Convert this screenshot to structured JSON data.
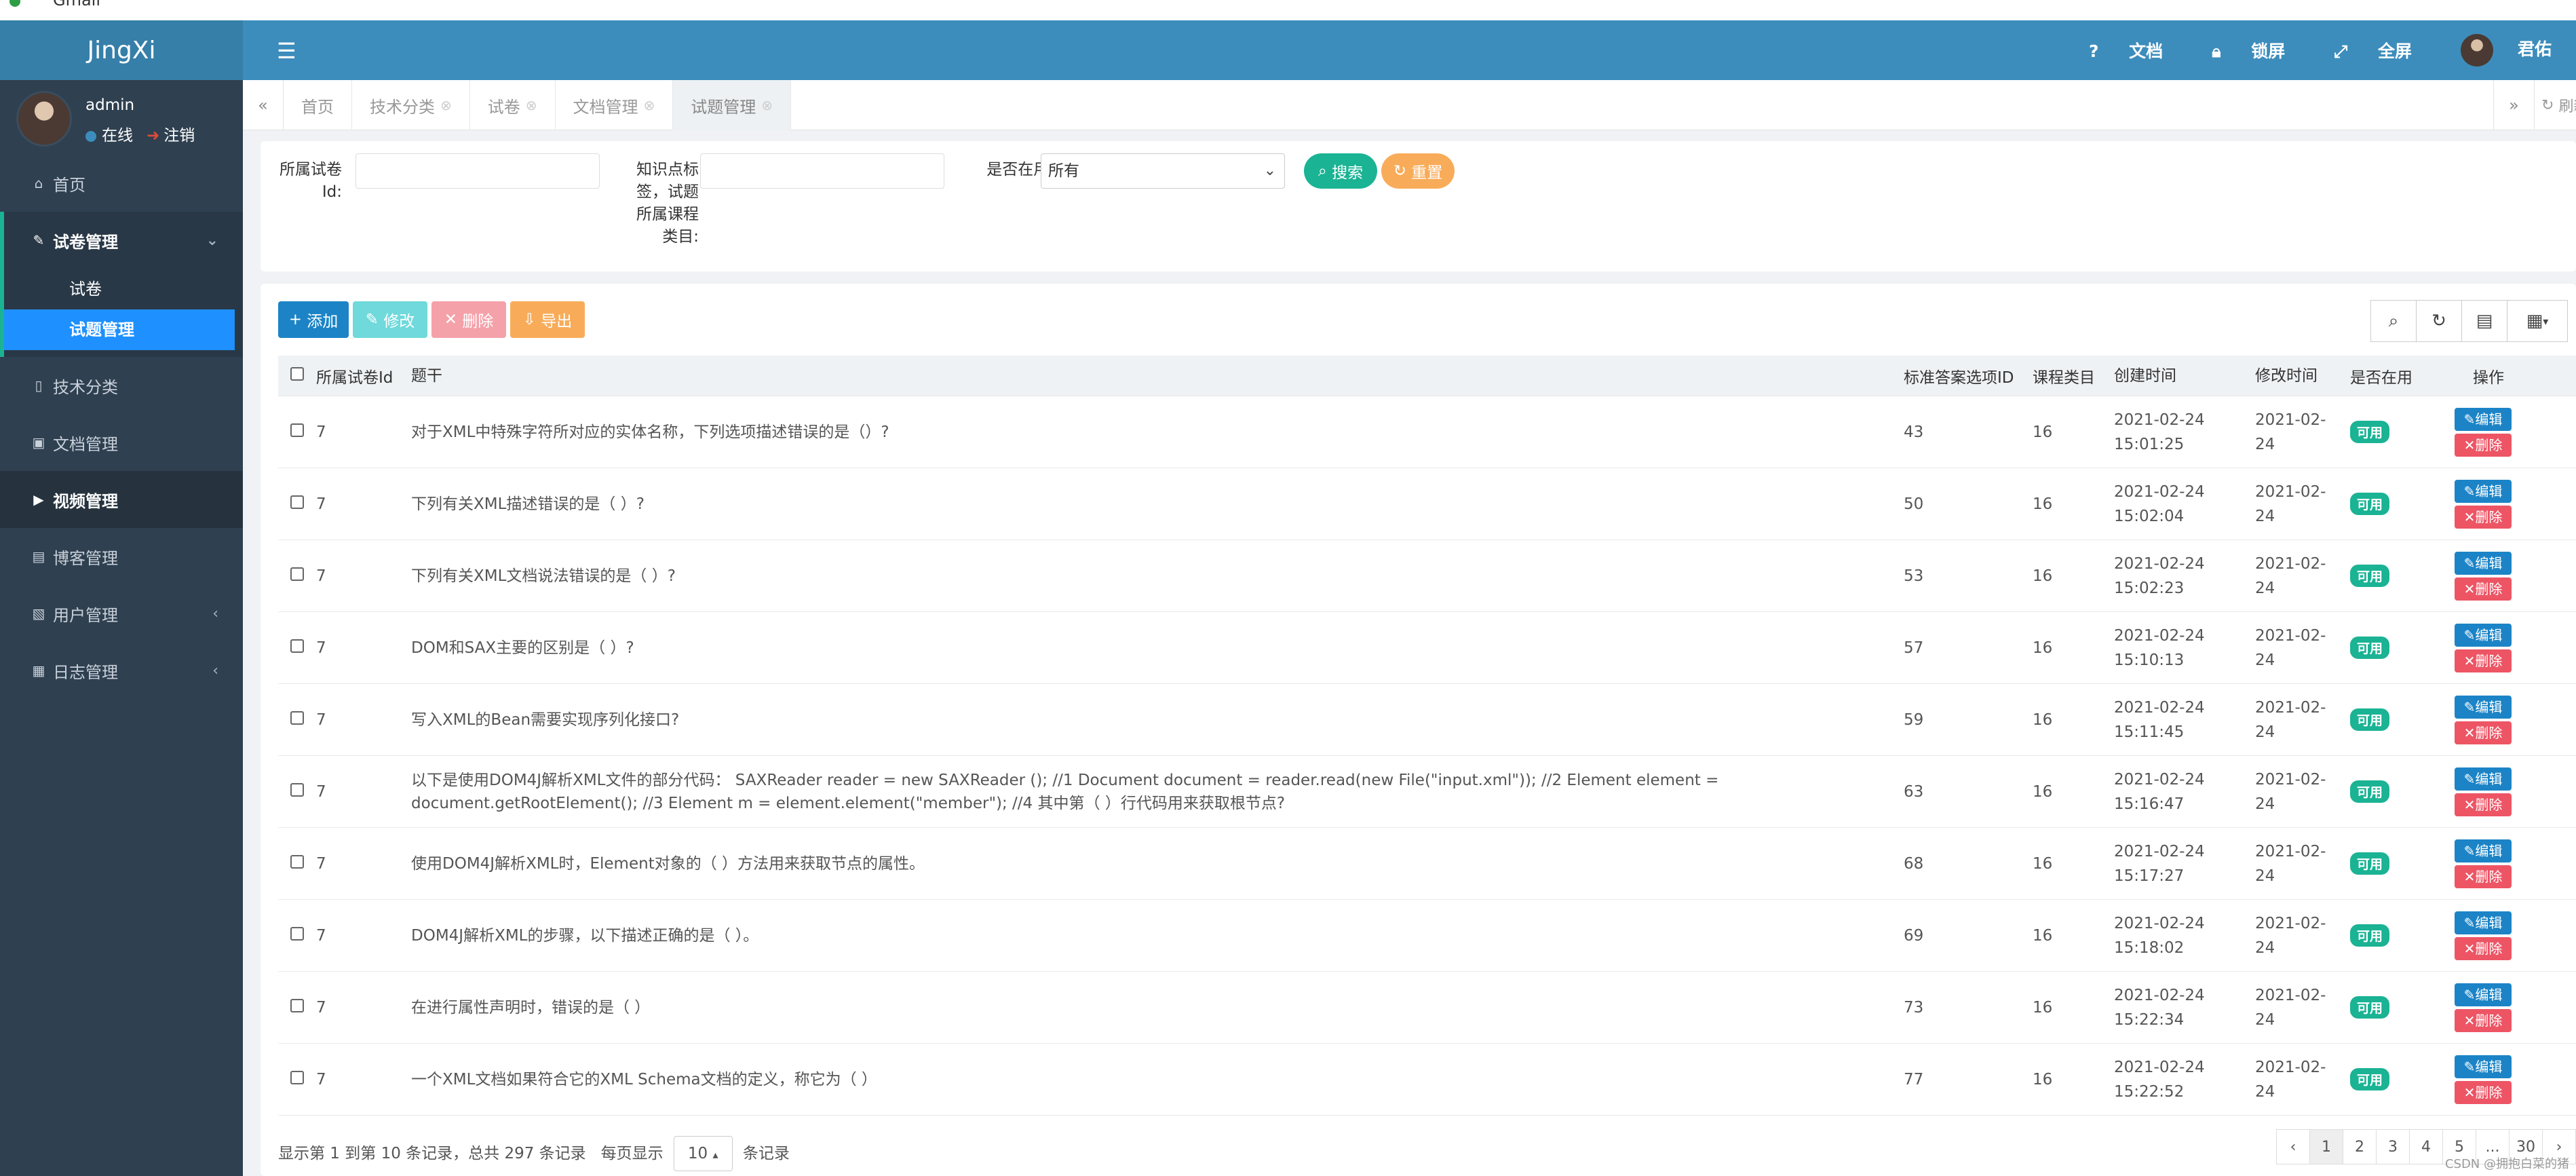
{
  "topstrip": {
    "name": "Gmail"
  },
  "app": {
    "logo": "JingXi"
  },
  "user": {
    "name": "admin",
    "status": "在线",
    "logout": "注销"
  },
  "sidebar": {
    "items": [
      {
        "label": "首页",
        "icon": "home-icon"
      },
      {
        "label": "试卷管理",
        "icon": "paper-icon",
        "sub": [
          "试卷",
          "试题管理"
        ]
      },
      {
        "label": "技术分类",
        "icon": "book-icon"
      },
      {
        "label": "文档管理",
        "icon": "doc-icon"
      },
      {
        "label": "视频管理",
        "icon": "video-icon"
      },
      {
        "label": "博客管理",
        "icon": "blog-icon"
      },
      {
        "label": "用户管理",
        "icon": "user-icon"
      },
      {
        "label": "日志管理",
        "icon": "calendar-icon"
      }
    ]
  },
  "header": {
    "docs": "文档",
    "lock": "锁屏",
    "fullscreen": "全屏",
    "account": "君佑"
  },
  "tabs": [
    "首页",
    "技术分类",
    "试卷",
    "文档管理",
    "试题管理"
  ],
  "tab_refresh": "刷新",
  "search": {
    "paper_id_label": "所属试卷Id:",
    "tags_label": "知识点标签，试题所属课程类目:",
    "in_use_label": "是否在用:",
    "in_use_value": "所有",
    "search_btn": "搜索",
    "reset_btn": "重置"
  },
  "toolbar": {
    "add": "添加",
    "edit": "修改",
    "delete": "删除",
    "export": "导出"
  },
  "table": {
    "headers": [
      "所属试卷Id",
      "题干",
      "标准答案选项ID",
      "课程类目",
      "创建时间",
      "修改时间",
      "是否在用",
      "操作"
    ],
    "rows": [
      {
        "pid": "7",
        "q": "对于XML中特殊字符所对应的实体名称，下列选项描述错误的是（）?",
        "ans": "43",
        "cat": "16",
        "ct1": "2021-02-24",
        "ct2": "15:01:25",
        "mt1": "2021-02-",
        "mt2": "24",
        "use": "可用"
      },
      {
        "pid": "7",
        "q": "下列有关XML描述错误的是（ ）?",
        "ans": "50",
        "cat": "16",
        "ct1": "2021-02-24",
        "ct2": "15:02:04",
        "mt1": "2021-02-",
        "mt2": "24",
        "use": "可用"
      },
      {
        "pid": "7",
        "q": "下列有关XML文档说法错误的是（ ）?",
        "ans": "53",
        "cat": "16",
        "ct1": "2021-02-24",
        "ct2": "15:02:23",
        "mt1": "2021-02-",
        "mt2": "24",
        "use": "可用"
      },
      {
        "pid": "7",
        "q": "DOM和SAX主要的区别是（ ）?",
        "ans": "57",
        "cat": "16",
        "ct1": "2021-02-24",
        "ct2": "15:10:13",
        "mt1": "2021-02-",
        "mt2": "24",
        "use": "可用"
      },
      {
        "pid": "7",
        "q": "写入XML的Bean需要实现序列化接口?",
        "ans": "59",
        "cat": "16",
        "ct1": "2021-02-24",
        "ct2": "15:11:45",
        "mt1": "2021-02-",
        "mt2": "24",
        "use": "可用"
      },
      {
        "pid": "7",
        "q": "以下是使用DOM4J解析XML文件的部分代码： SAXReader reader = new SAXReader (); //1 Document document = reader.read(new File(\"input.xml\")); //2 Element element = document.getRootElement(); //3 Element m = element.element(\"member\"); //4 其中第（ ）行代码用来获取根节点?",
        "ans": "63",
        "cat": "16",
        "ct1": "2021-02-24",
        "ct2": "15:16:47",
        "mt1": "2021-02-",
        "mt2": "24",
        "use": "可用"
      },
      {
        "pid": "7",
        "q": "使用DOM4J解析XML时，Element对象的（ ）方法用来获取节点的属性。",
        "ans": "68",
        "cat": "16",
        "ct1": "2021-02-24",
        "ct2": "15:17:27",
        "mt1": "2021-02-",
        "mt2": "24",
        "use": "可用"
      },
      {
        "pid": "7",
        "q": "DOM4J解析XML的步骤，以下描述正确的是（ ）。",
        "ans": "69",
        "cat": "16",
        "ct1": "2021-02-24",
        "ct2": "15:18:02",
        "mt1": "2021-02-",
        "mt2": "24",
        "use": "可用"
      },
      {
        "pid": "7",
        "q": "在进行属性声明时，错误的是（ ）",
        "ans": "73",
        "cat": "16",
        "ct1": "2021-02-24",
        "ct2": "15:22:34",
        "mt1": "2021-02-",
        "mt2": "24",
        "use": "可用"
      },
      {
        "pid": "7",
        "q": "一个XML文档如果符合它的XML Schema文档的定义，称它为（ ）",
        "ans": "77",
        "cat": "16",
        "ct1": "2021-02-24",
        "ct2": "15:22:52",
        "mt1": "2021-02-",
        "mt2": "24",
        "use": "可用"
      }
    ],
    "edit_label": "编辑",
    "delete_label": "删除"
  },
  "footer": {
    "info": "显示第 1 到第 10 条记录，总共 297 条记录",
    "per_page_prefix": "每页显示",
    "per_page": "10",
    "per_page_suffix": "条记录",
    "pages": [
      "‹",
      "1",
      "2",
      "3",
      "4",
      "5",
      "...",
      "30",
      "›"
    ]
  },
  "watermark": "CSDN @拥抱白菜的猪",
  "colors": {
    "sidebar": "#2f4050",
    "header": "#3c8dbc",
    "primary": "#1c84c6",
    "success": "#1ab394",
    "danger": "#ed5565",
    "warning": "#f8ac59",
    "active_sub": "#1e90ff"
  }
}
